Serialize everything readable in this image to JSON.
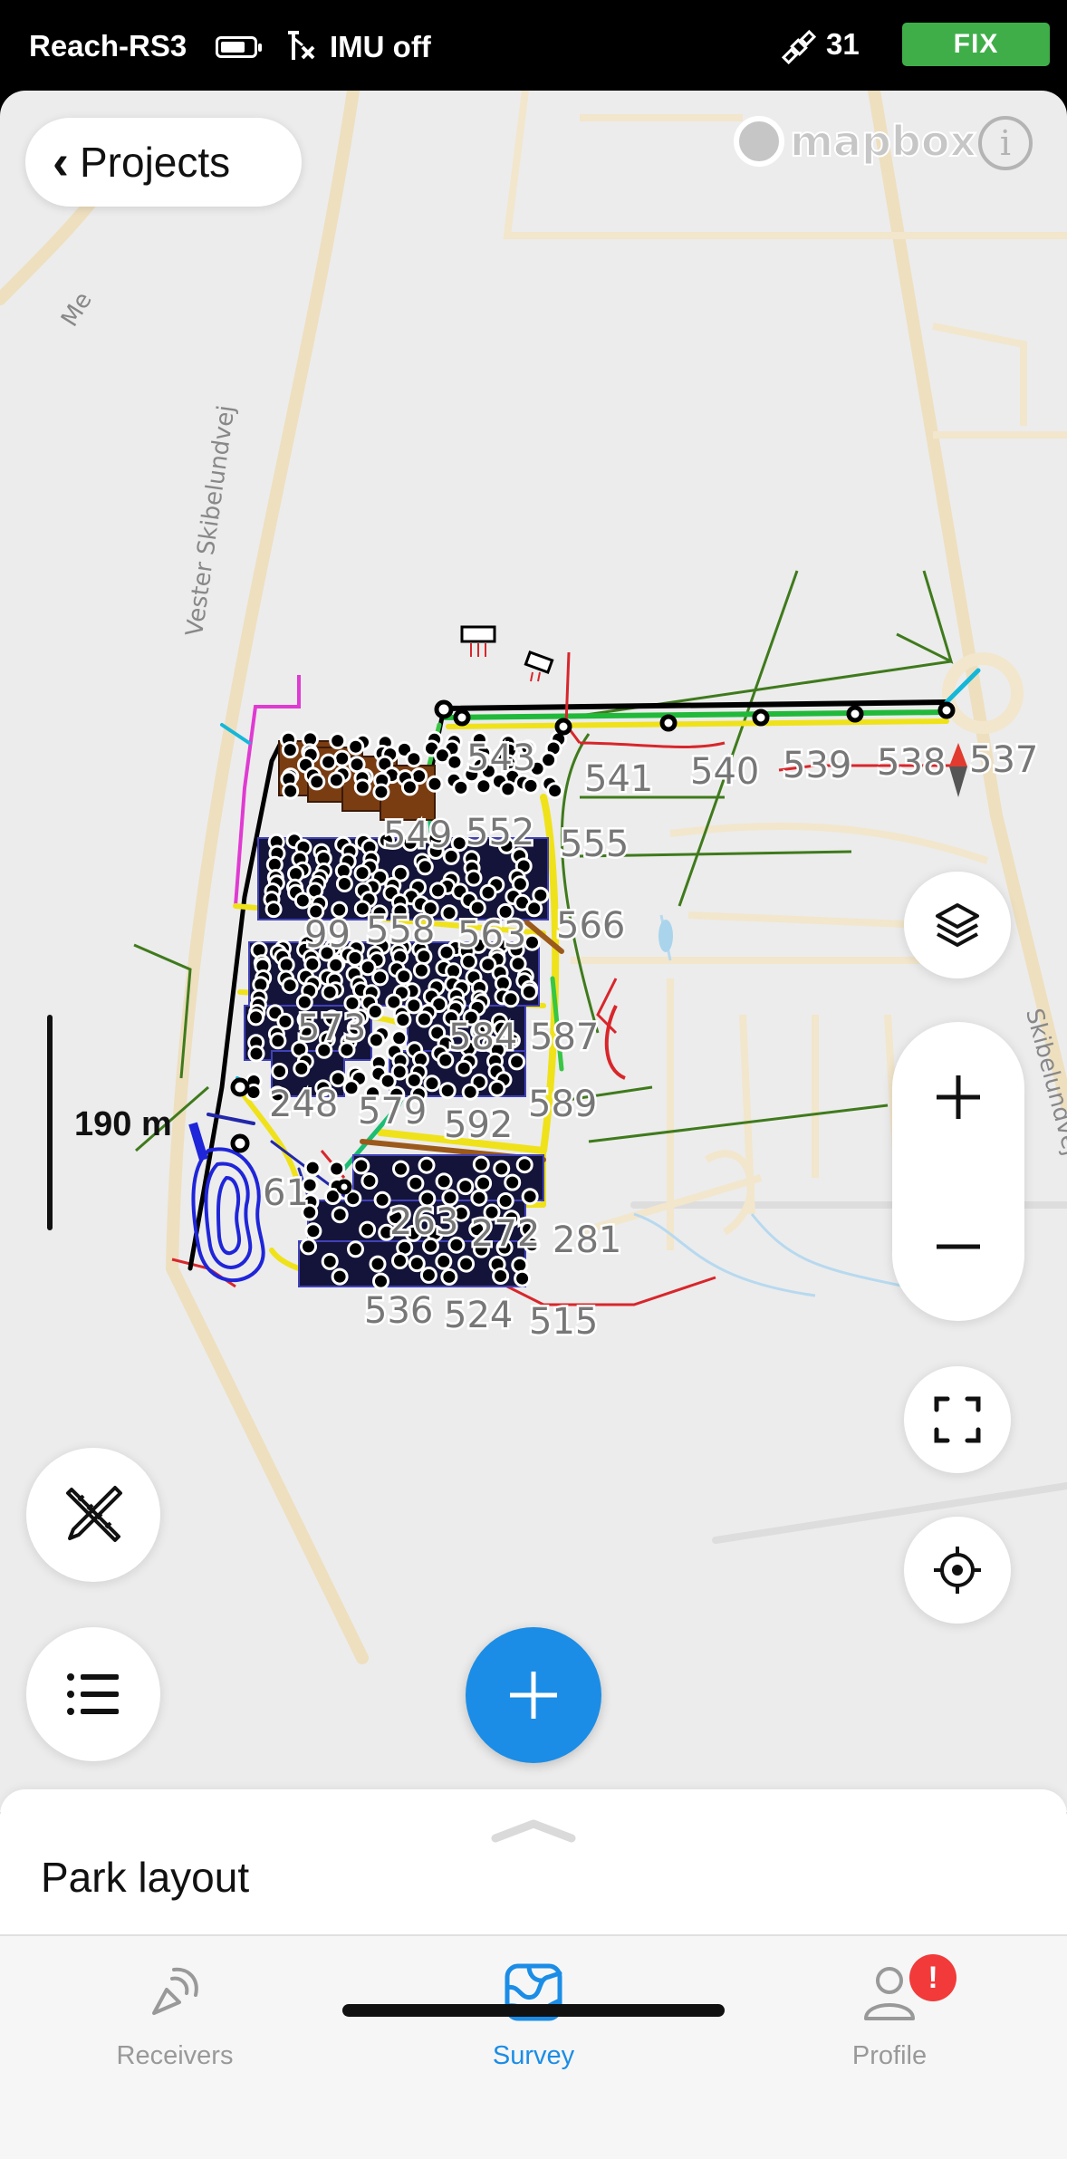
{
  "status_bar": {
    "device": "Reach-RS3",
    "imu": "IMU off",
    "satellites": "31",
    "fix": "FIX"
  },
  "map": {
    "back_button": "Projects",
    "attribution": "mapbox",
    "info": "i",
    "scale": "190 m",
    "road_labels": {
      "vester": "Vester Skibelundvej",
      "skibelund": "Skibelundvej",
      "me": "Me"
    },
    "point_labels": [
      "543",
      "541",
      "540",
      "539",
      "538",
      "537",
      "549",
      "552",
      "555",
      "99",
      "558",
      "563",
      "566",
      "573",
      "584",
      "587",
      "248",
      "579",
      "592",
      "589",
      "61",
      "263",
      "272",
      "281",
      "536",
      "524",
      "515"
    ]
  },
  "bottom_sheet": {
    "title": "Park layout"
  },
  "tabs": [
    {
      "label": "Receivers"
    },
    {
      "label": "Survey"
    },
    {
      "label": "Profile"
    }
  ],
  "profile_badge": "!"
}
